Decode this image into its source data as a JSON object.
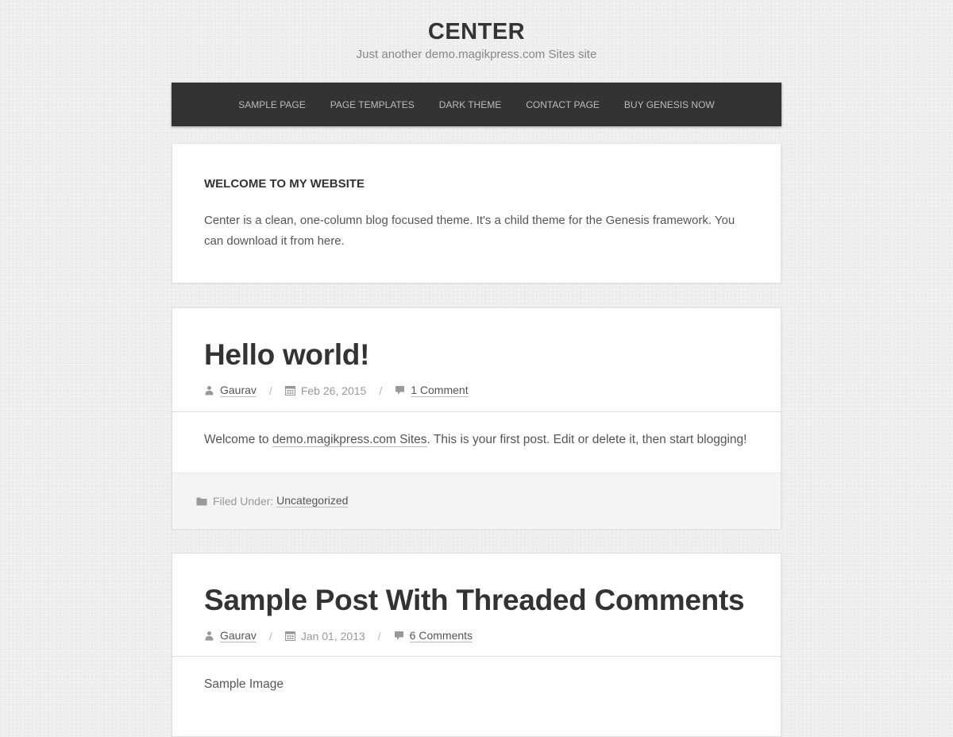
{
  "header": {
    "site_title": "CENTER",
    "site_description": "Just another demo.magikpress.com Sites site"
  },
  "nav": {
    "items": [
      {
        "label": "SAMPLE PAGE"
      },
      {
        "label": "PAGE TEMPLATES"
      },
      {
        "label": "DARK THEME"
      },
      {
        "label": "CONTACT PAGE"
      },
      {
        "label": "BUY GENESIS NOW"
      }
    ]
  },
  "widget": {
    "title": "WELCOME TO MY WEBSITE",
    "text": "Center is a clean, one-column blog focused theme. It's a child theme for the Genesis framework. You can download it from here."
  },
  "posts": [
    {
      "title": "Hello world!",
      "author": "Gaurav",
      "date": "Feb 26, 2015",
      "comments": "1 Comment",
      "body_prefix": "Welcome to ",
      "body_link": "demo.magikpress.com Sites",
      "body_suffix": ". This is your first post. Edit or delete it, then start blogging!",
      "filed_label": "Filed Under:",
      "category": "Uncategorized"
    },
    {
      "title": "Sample Post With Threaded Comments",
      "author": "Gaurav",
      "date": "Jan 01, 2013",
      "comments": "6 Comments",
      "body_text": "Sample Image"
    }
  ],
  "colors": {
    "nav_background": "#333333",
    "page_background": "#efefef",
    "card_background": "#ffffff",
    "footer_background": "#f4f4f4"
  },
  "icons": {
    "author": "user-icon",
    "date": "calendar-icon",
    "comments": "comment-icon",
    "category": "folder-icon"
  }
}
